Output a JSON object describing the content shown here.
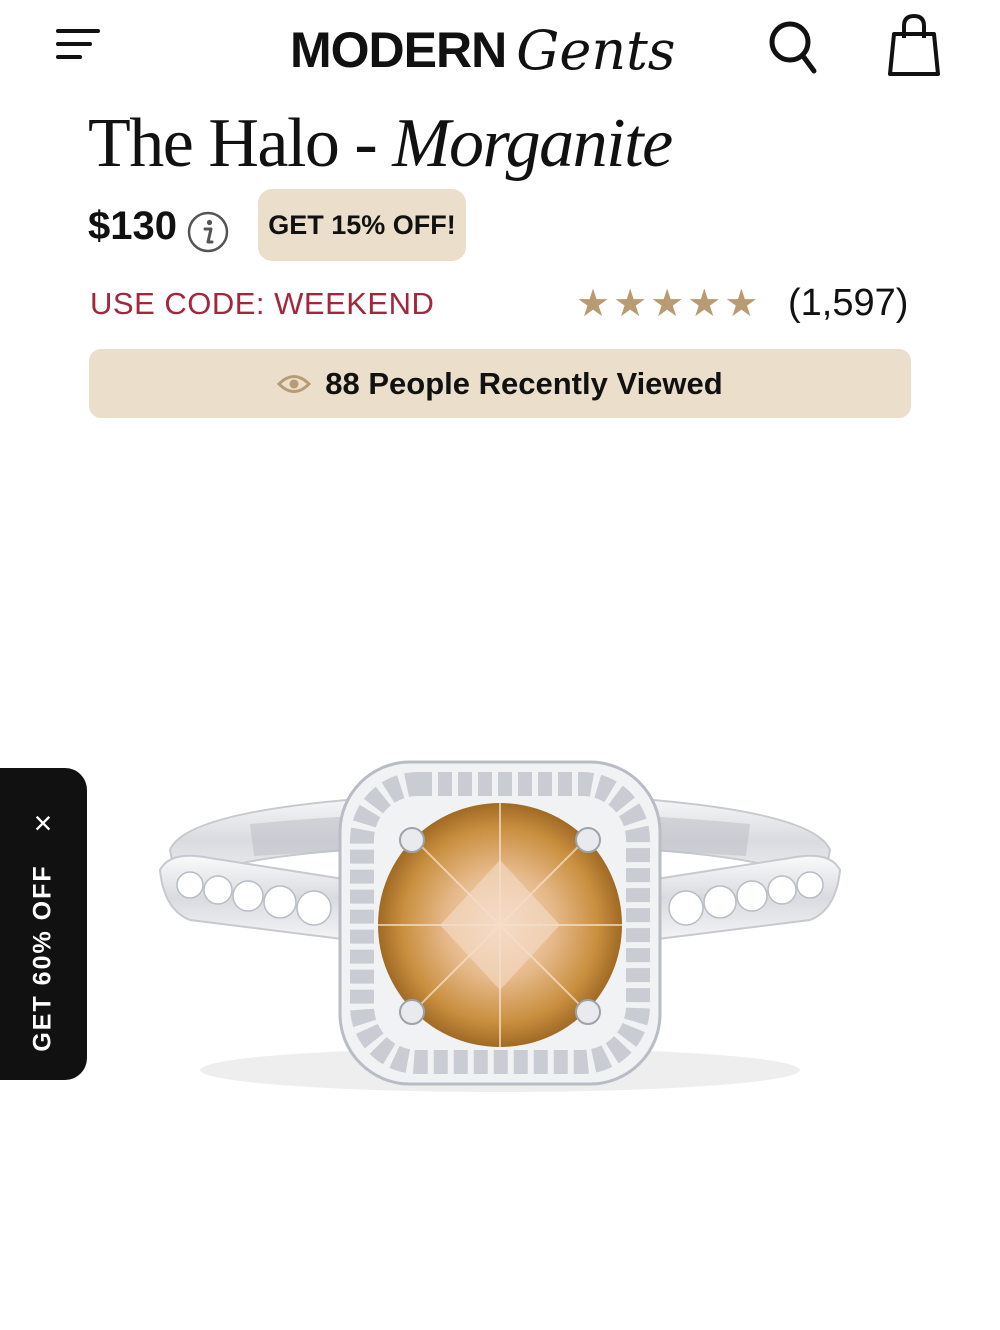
{
  "header": {
    "logo_primary": "MODERN",
    "logo_script": "Gents",
    "icons": [
      "menu-icon",
      "search-icon",
      "shopping-bag-icon"
    ]
  },
  "product": {
    "title_main": "The Halo - ",
    "title_italic": "Morganite",
    "price": "$130",
    "promo_button": "GET 15% OFF!",
    "code_text": "USE CODE: WEEKEND",
    "rating_stars": 5,
    "review_count": "(1,597)",
    "viewed_text": "88 People Recently Viewed"
  },
  "side_tab": {
    "label": "GET 60% OFF",
    "close": "×"
  },
  "colors": {
    "accent_beige": "#ebdfcb",
    "star_gold": "#b99b73",
    "code_red": "#a4263b",
    "dark": "#111111"
  }
}
